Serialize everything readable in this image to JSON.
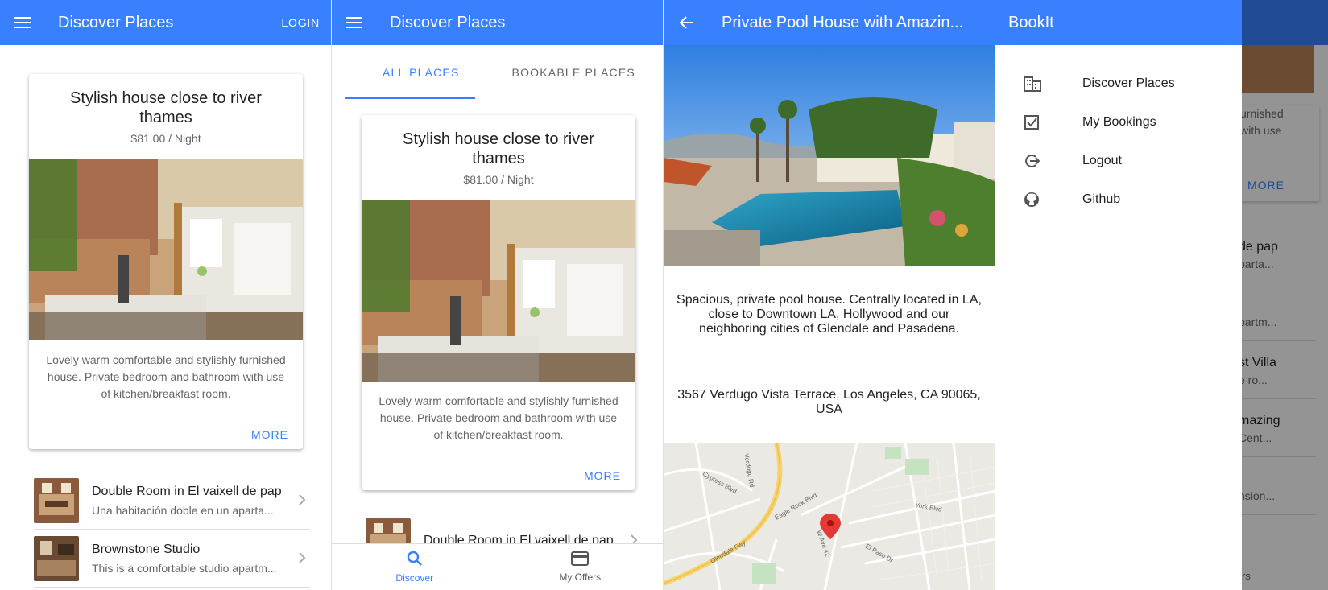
{
  "colors": {
    "primary": "#3880ff",
    "text": "#222222",
    "muted": "#666666"
  },
  "panel1": {
    "toolbar": {
      "menu_icon": "menu-icon",
      "title": "Discover Places",
      "login": "LOGIN"
    },
    "featured": {
      "title": "Stylish house close to river thames",
      "price": "$81.00 / Night",
      "description": "Lovely warm comfortable and stylishly furnished house. Private bedroom and bathroom with use of kitchen/breakfast room.",
      "more": "MORE"
    },
    "list": [
      {
        "title": "Double Room in El vaixell de pap",
        "subtitle": "Una habitación doble en un aparta..."
      },
      {
        "title": "Brownstone Studio",
        "subtitle": "This is a comfortable studio apartm..."
      }
    ]
  },
  "panel2": {
    "toolbar": {
      "menu_icon": "menu-icon",
      "title": "Discover Places"
    },
    "tabs": [
      "ALL PLACES",
      "BOOKABLE PLACES"
    ],
    "featured": {
      "title": "Stylish house close to river thames",
      "price": "$81.00 / Night",
      "description": "Lovely warm comfortable and stylishly furnished house. Private bedroom and bathroom with use of kitchen/breakfast room.",
      "more": "MORE"
    },
    "list": [
      {
        "title": "Double Room in El vaixell de pap"
      }
    ],
    "bottom_tabs": [
      {
        "label": "Discover",
        "icon": "search-icon"
      },
      {
        "label": "My Offers",
        "icon": "card-icon"
      }
    ]
  },
  "panel3": {
    "toolbar": {
      "back_icon": "arrow-back-icon",
      "title": "Private Pool House with Amazin..."
    },
    "description": "Spacious, private pool house. Centrally located in LA, close to Downtown LA, Hollywood and our neighboring cities of Glendale and Pasadena.",
    "address": "3567 Verdugo Vista Terrace, Los Angeles, CA 90065, USA",
    "map_labels": [
      "Verdugo Rd",
      "Cypress Blvd",
      "Eagle Rock Blvd",
      "York Blvd",
      "Glendale Fwy",
      "El Paso Dr",
      "W Ave 42"
    ]
  },
  "panel4": {
    "toolbar": {
      "title": "BookIt"
    },
    "menu": [
      {
        "label": "Discover Places",
        "icon": "business-icon"
      },
      {
        "label": "My Bookings",
        "icon": "checkbox-icon"
      },
      {
        "label": "Logout",
        "icon": "logout-icon"
      },
      {
        "label": "Github",
        "icon": "github-icon"
      }
    ],
    "behind": {
      "text1": "urnished",
      "text2": "with use",
      "more": "MORE",
      "items": [
        {
          "title": "de pap",
          "subtitle": "parta..."
        },
        {
          "title": "",
          "subtitle": "partm..."
        },
        {
          "title": "st Villa",
          "subtitle": "e ro..."
        },
        {
          "title": "mazing",
          "subtitle": "Cent..."
        },
        {
          "title": "",
          "subtitle": "nsion..."
        }
      ],
      "footer": "rs"
    }
  }
}
